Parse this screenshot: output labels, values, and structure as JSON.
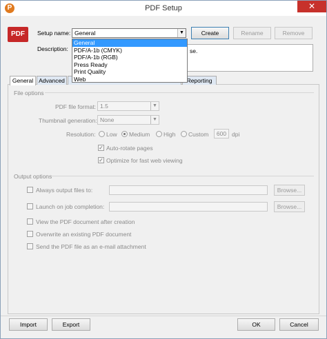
{
  "window": {
    "title": "PDF Setup",
    "app_icon": "P",
    "close": "✕"
  },
  "logo": {
    "text": "PDF"
  },
  "setup": {
    "setup_name_label": "Setup name:",
    "setup_name_value": "General",
    "create": "Create",
    "rename": "Rename",
    "remove": "Remove",
    "description_label": "Description:",
    "description_value": "se.",
    "dropdown_options": [
      "General",
      "PDF/A-1b (CMYK)",
      "PDF/A-1b (RGB)",
      "Press Ready",
      "Print Quality",
      "Web"
    ]
  },
  "tabs": [
    "General",
    "Advanced",
    "Reporting"
  ],
  "file_options": {
    "group_label": "File options",
    "pdf_format_label": "PDF file format:",
    "pdf_format_value": "1.5",
    "thumbnail_label": "Thumbnail generation:",
    "thumbnail_value": "None",
    "resolution_label": "Resolution:",
    "res_low": "Low",
    "res_medium": "Medium",
    "res_high": "High",
    "res_custom": "Custom",
    "res_custom_value": "600",
    "res_unit": "dpi",
    "auto_rotate": "Auto-rotate pages",
    "optimize_web": "Optimize for fast web viewing"
  },
  "output_options": {
    "group_label": "Output options",
    "always_output": "Always output files to:",
    "launch_on_completion": "Launch on job completion:",
    "browse": "Browse...",
    "view_pdf": "View the PDF document after creation",
    "overwrite": "Overwrite an existing PDF document",
    "send_email": "Send the PDF file as an e-mail attachment"
  },
  "footer": {
    "import": "Import",
    "export": "Export",
    "ok": "OK",
    "cancel": "Cancel"
  }
}
